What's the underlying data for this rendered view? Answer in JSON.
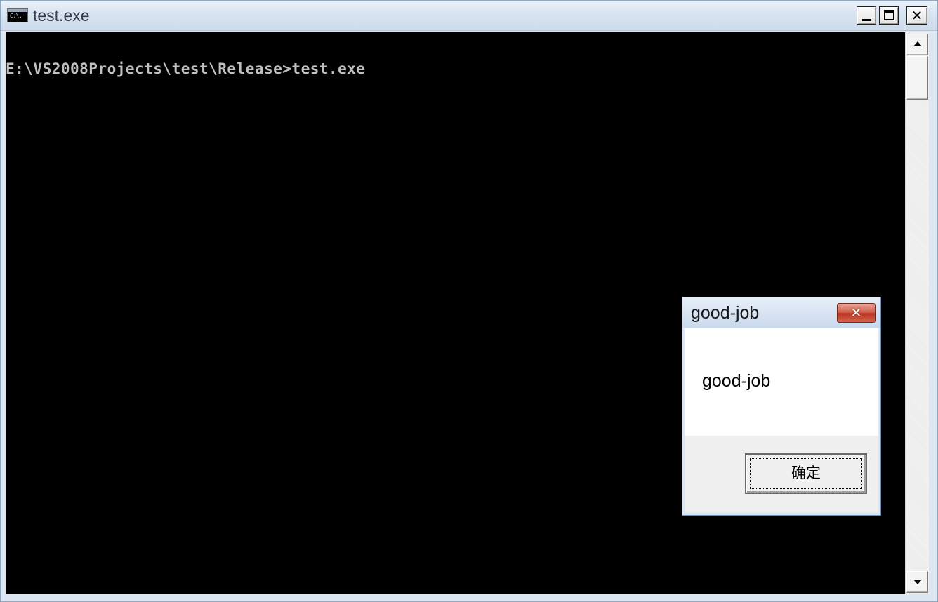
{
  "window": {
    "title": "test.exe",
    "icon": "console-icon",
    "icon_text": "C:\\."
  },
  "controls": {
    "minimize": "minimize-icon",
    "maximize": "maximize-icon",
    "close": "close-icon",
    "close_glyph": "✕"
  },
  "console": {
    "lines": [
      "E:\\VS2008Projects\\test\\Release>test.exe"
    ],
    "background_color": "#000000",
    "text_color": "#c0c0c0"
  },
  "dialog": {
    "title": "good-job",
    "message": "good-job",
    "ok_label": "确定",
    "close_glyph": "✕",
    "close_color": "#c9452f"
  }
}
